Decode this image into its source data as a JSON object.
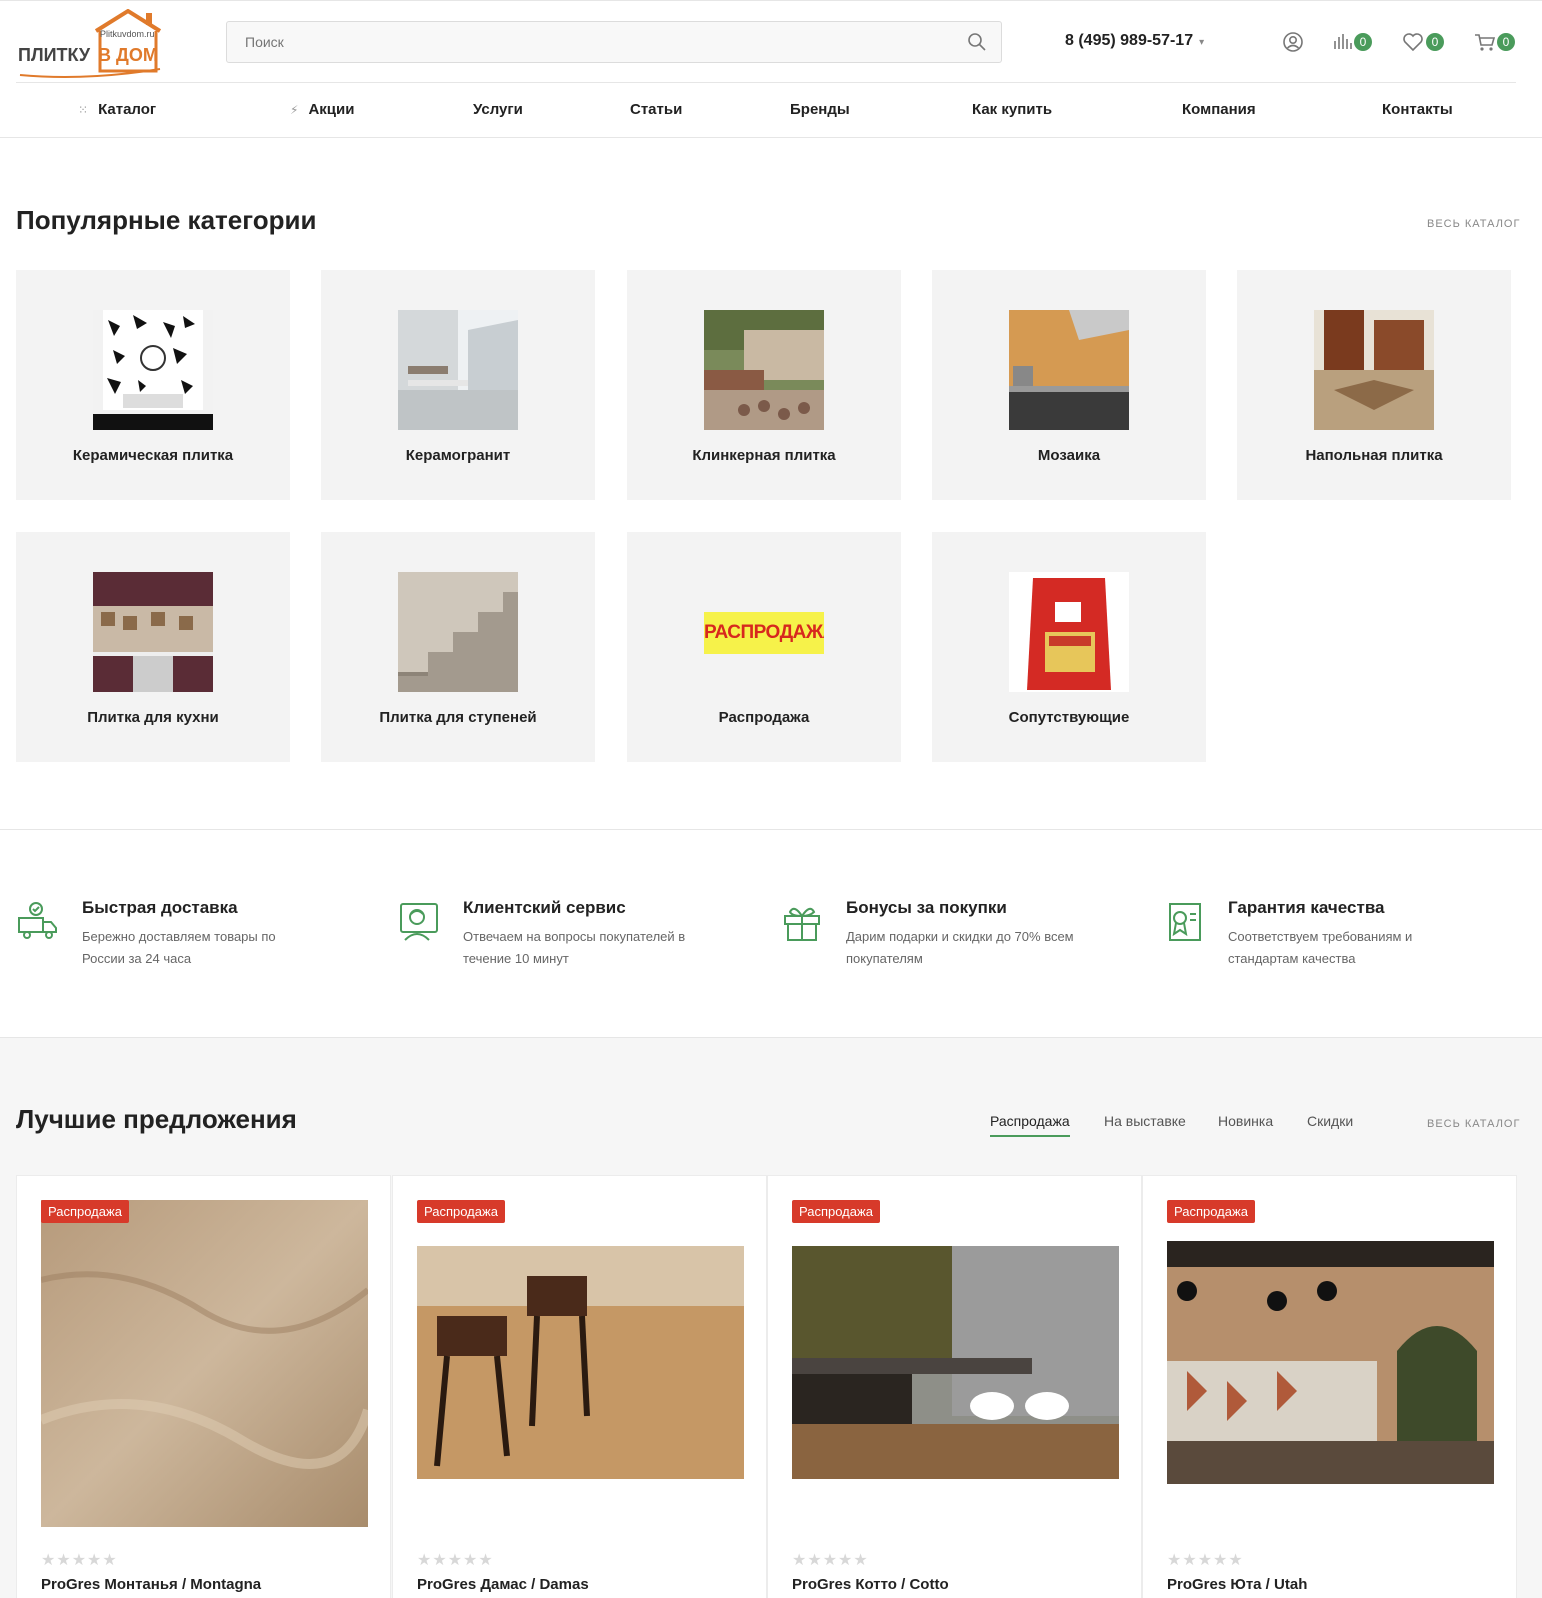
{
  "header": {
    "logo_url_text": "Plitkuvdom.ru",
    "logo_text_left": "ПЛИТКУ",
    "logo_text_right": "В ДОМ",
    "search_placeholder": "Поиск",
    "phone": "8 (495) 989-57-17",
    "compare_count": "0",
    "favorites_count": "0",
    "cart_count": "0"
  },
  "nav": {
    "items": [
      "Каталог",
      "Акции",
      "Услуги",
      "Статьи",
      "Бренды",
      "Как купить",
      "Компания",
      "Контакты"
    ]
  },
  "popular": {
    "title": "Популярные категории",
    "all_link": "ВЕСЬ КАТАЛОГ",
    "categories": [
      "Керамическая плитка",
      "Керамогранит",
      "Клинкерная плитка",
      "Мозаика",
      "Напольная плитка",
      "Плитка для кухни",
      "Плитка для ступеней",
      "Распродажа",
      "Сопутствующие"
    ],
    "sale_banner_text": "РАСПРОДАЖА"
  },
  "features": [
    {
      "title": "Быстрая доставка",
      "desc": "Бережно доставляем товары по России за 24 часа",
      "icon": "delivery-truck-icon"
    },
    {
      "title": "Клиентский сервис",
      "desc": "Отвечаем на вопросы покупателей в течение 10 минут",
      "icon": "support-agent-icon"
    },
    {
      "title": "Бонусы за покупки",
      "desc": "Дарим подарки и скидки до 70% всем покупателям",
      "icon": "gift-icon"
    },
    {
      "title": "Гарантия качества",
      "desc": "Соответствуем требованиям и стандартам качества",
      "icon": "certificate-icon"
    }
  ],
  "offers": {
    "title": "Лучшие предложения",
    "tabs": [
      "Распродажа",
      "На выставке",
      "Новинка",
      "Скидки"
    ],
    "active_tab": "Распродажа",
    "all_link": "ВЕСЬ КАТАЛОГ",
    "products": [
      {
        "badge": "Распродажа",
        "name": "ProGres Монтанья / Montagna",
        "rating": 0
      },
      {
        "badge": "Распродажа",
        "name": "ProGres Дамас / Damas",
        "rating": 0
      },
      {
        "badge": "Распродажа",
        "name": "ProGres Котто / Cotto",
        "rating": 0
      },
      {
        "badge": "Распродажа",
        "name": "ProGres Юта / Utah",
        "rating": 0
      }
    ],
    "stars_text": "★★★★★"
  },
  "colors": {
    "accent_green": "#4a9b5b",
    "brand_orange": "#e07a2b",
    "sale_red": "#d73a2a"
  }
}
